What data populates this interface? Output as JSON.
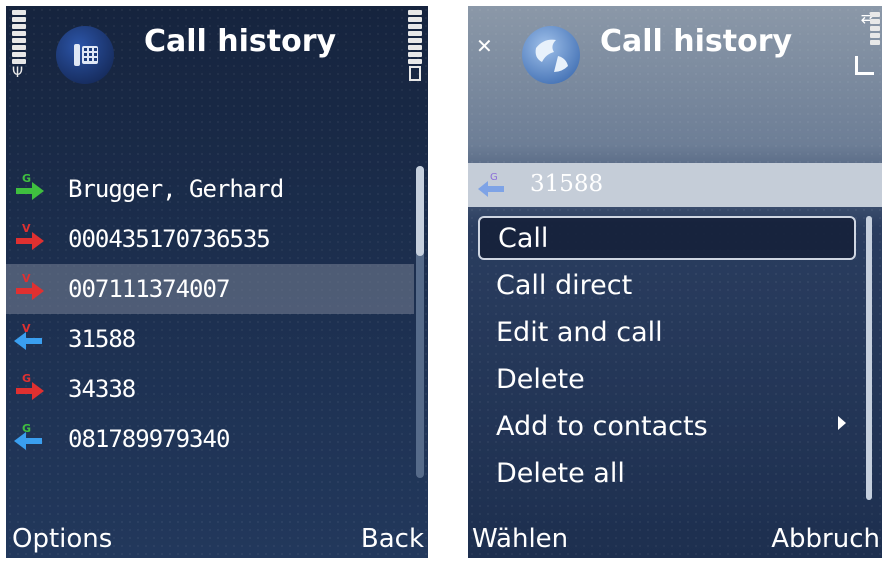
{
  "left_screen": {
    "title": "Call history",
    "items": [
      {
        "label": "Brugger, Gerhard",
        "icon": "dialed-call-icon",
        "color": "#3fbf3f",
        "letter": "G"
      },
      {
        "label": "000435170736535",
        "icon": "missed-call-icon",
        "color": "#e03030",
        "letter": "V"
      },
      {
        "label": "007111374007",
        "icon": "missed-call-icon",
        "color": "#e03030",
        "letter": "V"
      },
      {
        "label": "31588",
        "icon": "received-call-icon",
        "color": "#3a9ff0",
        "letter": "V"
      },
      {
        "label": "34338",
        "icon": "missed-call-icon",
        "color": "#e03030",
        "letter": "G"
      },
      {
        "label": "081789979340",
        "icon": "received-call-icon",
        "color": "#3a9ff0",
        "letter": "G"
      }
    ],
    "selected_index": 2,
    "softkey_left": "Options",
    "softkey_right": "Back"
  },
  "right_screen": {
    "title": "Call history",
    "highlighted_entry": "31588",
    "menu": [
      {
        "label": "Call"
      },
      {
        "label": "Call direct"
      },
      {
        "label": "Edit and call"
      },
      {
        "label": "Delete"
      },
      {
        "label": "Add to contacts",
        "submenu": true
      },
      {
        "label": "Delete all"
      }
    ],
    "focused_index": 0,
    "softkey_left": "Wählen",
    "softkey_right": "Abbruch"
  }
}
